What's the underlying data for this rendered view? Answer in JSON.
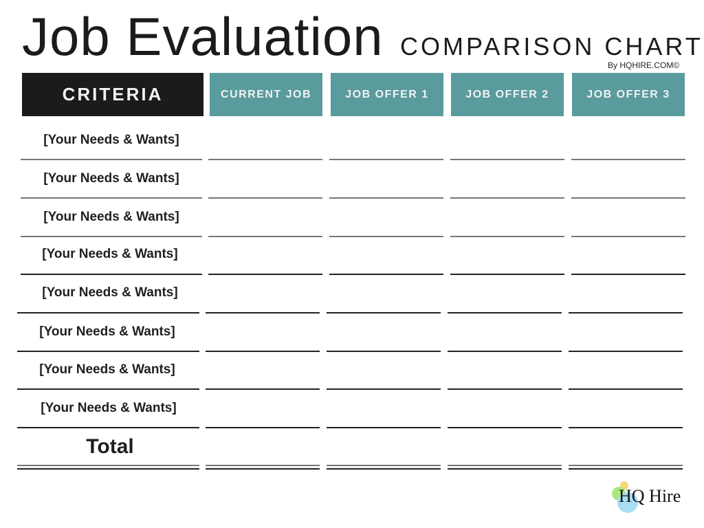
{
  "header": {
    "title": "Job Evaluation",
    "subtitle": "COMPARISON CHART",
    "byline": "By HQHIRE.COM©"
  },
  "table": {
    "columns": [
      "CRITERIA",
      "CURRENT JOB",
      "JOB OFFER 1",
      "JOB OFFER 2",
      "JOB OFFER 3"
    ],
    "rows": [
      {
        "label": "[Your Needs & Wants]",
        "values": [
          "",
          "",
          "",
          ""
        ]
      },
      {
        "label": "[Your Needs & Wants]",
        "values": [
          "",
          "",
          "",
          ""
        ]
      },
      {
        "label": "[Your Needs & Wants]",
        "values": [
          "",
          "",
          "",
          ""
        ]
      },
      {
        "label": "[Your Needs & Wants]",
        "values": [
          "",
          "",
          "",
          ""
        ]
      },
      {
        "label": "[Your Needs & Wants]",
        "values": [
          "",
          "",
          "",
          ""
        ]
      },
      {
        "label": "[Your Needs & Wants]",
        "values": [
          "",
          "",
          "",
          ""
        ]
      },
      {
        "label": "[Your Needs & Wants]",
        "values": [
          "",
          "",
          "",
          ""
        ]
      },
      {
        "label": "[Your Needs & Wants]",
        "values": [
          "",
          "",
          "",
          ""
        ]
      }
    ],
    "total_label": "Total",
    "total_values": [
      "",
      "",
      "",
      ""
    ]
  },
  "colors": {
    "criteria_header": "#1b1b1b",
    "job_header": "#5a9b9e",
    "header_text": "#f3f3f3"
  },
  "logo": {
    "text": "HQ Hire",
    "dot_colors": [
      "#f7d774",
      "#a8e87c",
      "#a9dcf5"
    ]
  }
}
